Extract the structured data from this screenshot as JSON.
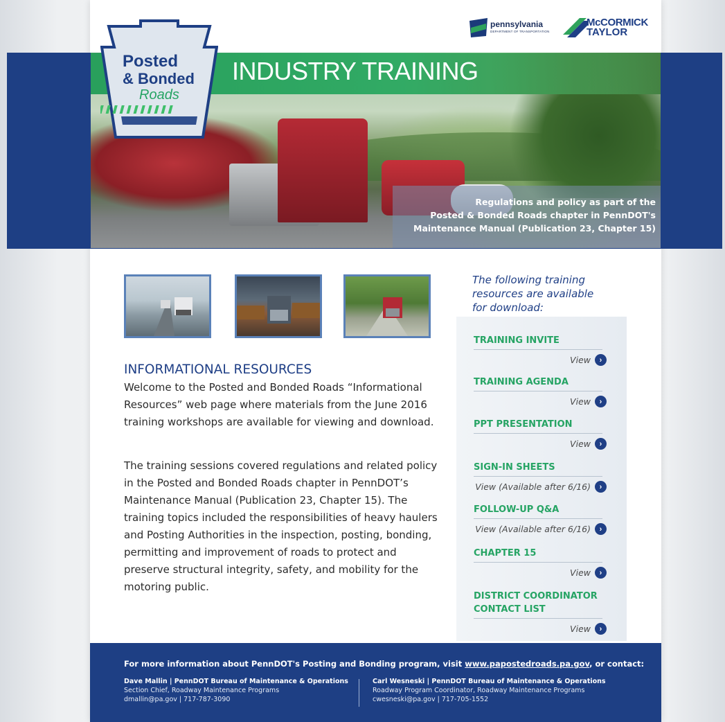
{
  "brand": {
    "logo_line1": "Posted",
    "logo_line2": "& Bonded",
    "logo_line3": "Roads",
    "penndot_name": "pennsylvania",
    "penndot_sub": "DEPARTMENT OF TRANSPORTATION",
    "mccormick_line1": "McCORMICK",
    "mccormick_line2": "TAYLOR"
  },
  "hero": {
    "title": "INDUSTRY TRAINING",
    "caption_line1": "Regulations and policy as part of the",
    "caption_line2": "Posted & Bonded Roads chapter in PennDOT's",
    "caption_line3": "Maintenance Manual (Publication 23, Chapter 15)"
  },
  "main": {
    "heading": "INFORMATIONAL RESOURCES",
    "para1": "Welcome to the Posted and Bonded Roads “Informational Resources” web page where materials from the June 2016 training workshops are available for viewing and download.",
    "para2": "The training sessions covered regulations and related policy in the Posted and Bonded Roads chapter in PennDOT’s Maintenance Manual (Publication 23, Chapter 15). The training topics included the responsibilities of heavy haulers and Posting Authorities in the inspection, posting, bonding, permitting and improvement of roads to protect and preserve structural integrity, safety, and mobility for the motoring public."
  },
  "sidebar": {
    "intro": "The following training resources are available for download:",
    "items": [
      {
        "title": "TRAINING INVITE",
        "view": "View"
      },
      {
        "title": "TRAINING AGENDA",
        "view": "View"
      },
      {
        "title": "PPT PRESENTATION",
        "view": "View"
      },
      {
        "title": "SIGN-IN SHEETS",
        "view": "View (Available after 6/16)"
      },
      {
        "title": "FOLLOW-UP Q&A",
        "view": "View (Available after 6/16)"
      },
      {
        "title": "CHAPTER 15",
        "view": "View"
      },
      {
        "title": "DISTRICT COORDINATOR CONTACT LIST",
        "view": "View"
      }
    ]
  },
  "footer": {
    "lead": "For more information about PennDOT's Posting and Bonding program, visit ",
    "link": "www.papostedroads.pa.gov",
    "tail": ", or contact:",
    "contact1": {
      "name": "Dave Mallin | PennDOT Bureau of Maintenance & Operations",
      "role": "Section Chief, Roadway Maintenance Programs",
      "info": "dmallin@pa.gov | 717-787-3090"
    },
    "contact2": {
      "name": "Carl Wesneski | PennDOT Bureau of Maintenance & Operations",
      "role": "Roadway Program Coordinator, Roadway Maintenance Programs",
      "info": "cwesneski@pa.gov | 717-705-1552"
    }
  },
  "colors": {
    "navy": "#1e3f84",
    "green_accent": "#26a464",
    "thumb_border": "#5a81b8"
  }
}
